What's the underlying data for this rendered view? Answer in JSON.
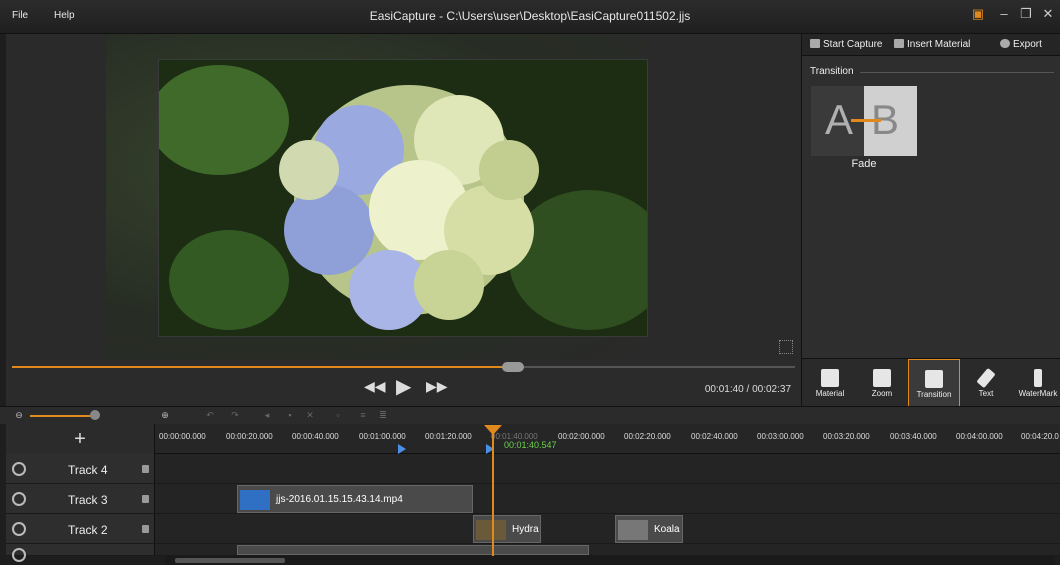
{
  "window": {
    "menu": [
      "File",
      "Help"
    ],
    "title": "EasiCapture - C:\\Users\\user\\Desktop\\EasiCapture011502.jjs"
  },
  "player": {
    "timecode": "00:01:40 / 00:02:37",
    "progress": 0.64
  },
  "panel": {
    "tabs": [
      {
        "label": "Start Capture",
        "icon": "camera-icon"
      },
      {
        "label": "Insert Material",
        "icon": "insert-icon"
      },
      {
        "label": "Export",
        "icon": "film-reel-icon"
      }
    ],
    "section_title": "Transition",
    "transitions": [
      {
        "label": "Fade",
        "letters": [
          "A",
          "B"
        ]
      }
    ],
    "tools": [
      {
        "label": "Material",
        "icon": "material-icon"
      },
      {
        "label": "Zoom",
        "icon": "zoom-icon"
      },
      {
        "label": "Transition",
        "icon": "transition-icon",
        "active": true
      },
      {
        "label": "Text",
        "icon": "pen-icon"
      },
      {
        "label": "WaterMark",
        "icon": "stamp-icon"
      }
    ]
  },
  "timeline": {
    "add_label": "+",
    "ruler": [
      "00:00:00.000",
      "00:00:20.000",
      "00:00:40.000",
      "00:01:00.000",
      "00:01:20.000",
      "00:01:40.000",
      "00:02:00.000",
      "00:02:20.000",
      "00:02:40.000",
      "00:03:00.000",
      "00:03:20.000",
      "00:03:40.000",
      "00:04:00.000",
      "00:04:20.0"
    ],
    "playhead_time": "00:01:40.547",
    "tracks": [
      {
        "name": "Track 4",
        "clips": []
      },
      {
        "name": "Track 3",
        "clips": [
          {
            "label": "jjs-2016.01.15.15.43.14.mp4"
          }
        ]
      },
      {
        "name": "Track 2",
        "clips": [
          {
            "label": "Hydra"
          },
          {
            "label": "Koala"
          }
        ]
      }
    ]
  },
  "colors": {
    "accent": "#e08a1e",
    "marker": "#4a90e8",
    "playhead_text": "#6ad04a"
  }
}
